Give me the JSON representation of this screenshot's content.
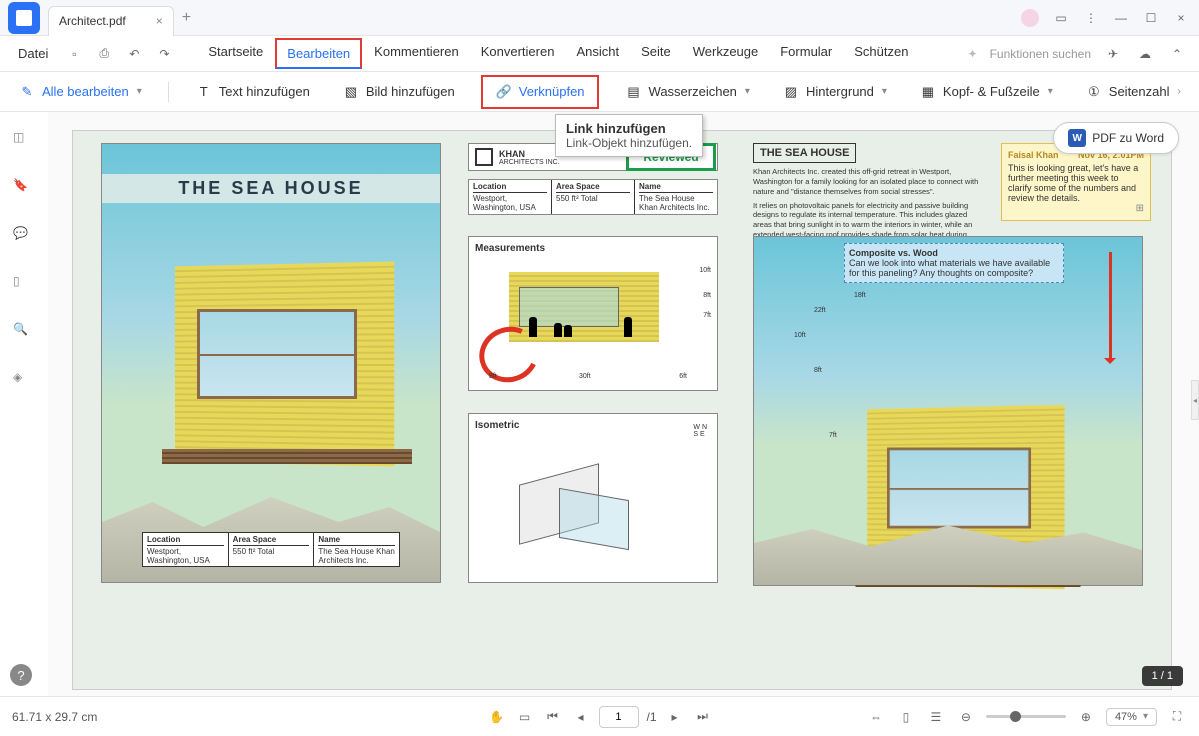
{
  "titlebar": {
    "filename": "Architect.pdf"
  },
  "menu": {
    "file": "Datei",
    "tabs": [
      "Startseite",
      "Bearbeiten",
      "Kommentieren",
      "Konvertieren",
      "Ansicht",
      "Seite",
      "Werkzeuge",
      "Formular",
      "Schützen"
    ],
    "active": "Bearbeiten",
    "search_placeholder": "Funktionen suchen"
  },
  "toolbar": {
    "edit_all": "Alle bearbeiten",
    "add_text": "Text hinzufügen",
    "add_image": "Bild hinzufügen",
    "link": "Verknüpfen",
    "watermark": "Wasserzeichen",
    "background": "Hintergrund",
    "header_footer": "Kopf- & Fußzeile",
    "page_number": "Seitenzahl"
  },
  "tooltip": {
    "title": "Link hinzufügen",
    "desc": "Link-Objekt hinzufügen."
  },
  "pdf_to_word": "PDF zu Word",
  "doc": {
    "title": "THE SEA HOUSE",
    "logo_text": "KHAN",
    "logo_sub": "ARCHITECTS INC.",
    "reviewed": "Reviewed",
    "info_labels": {
      "location": "Location",
      "area": "Area Space",
      "name": "Name"
    },
    "info_values": {
      "location": "Westport,\nWashington, USA",
      "area": "550 ft²\nTotal",
      "name": "The Sea House\nKhan Architects Inc."
    },
    "measurements": "Measurements",
    "meas_labels": [
      "10ft",
      "8ft",
      "7ft",
      "8ft",
      "30ft",
      "6ft"
    ],
    "isometric": "Isometric",
    "compass": [
      "W",
      "N",
      "S",
      "E"
    ],
    "heading2": "THE SEA HOUSE",
    "body": "Khan Architects Inc. created this off-grid retreat in Westport, Washington for a family looking for an isolated place to connect with nature and \"distance themselves from social stresses\".",
    "body2": "It relies on photovoltaic panels for electricity and passive building designs to regulate its internal temperature. This includes glazed areas that bring sunlight in to warm the interiors in winter, while an extended west-facing roof provides shade from solar heat during evenings in the summer.",
    "sticky": {
      "author": "Faisal Khan",
      "date": "Nov 16, 2:01PM",
      "text": "This is looking great, let's have a further meeting this week to clarify some of the numbers and review the details."
    },
    "comment": {
      "title": "Composite vs. Wood",
      "text": "Can we look into what materials we have available for this paneling? Any thoughts on composite?"
    },
    "review_dims": [
      "18ft",
      "22ft",
      "10ft",
      "8ft",
      "7ft"
    ]
  },
  "status": {
    "dimensions": "61.71 x 29.7 cm",
    "page_current": "1",
    "page_total": "/1",
    "zoom": "47%",
    "page_counter": "1 / 1"
  }
}
